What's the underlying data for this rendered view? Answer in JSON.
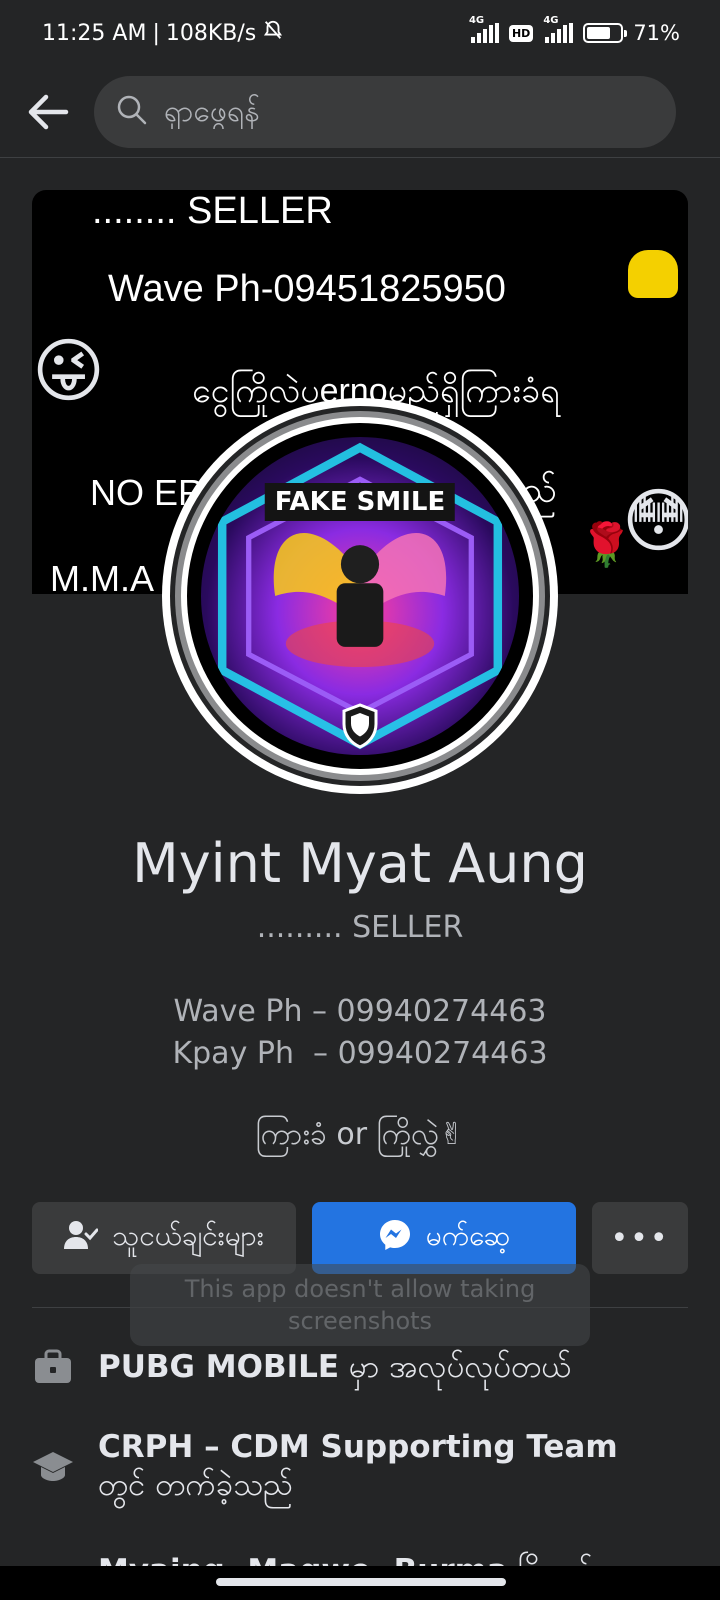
{
  "status_bar": {
    "time": "11:25 AM",
    "speed": "108KB/s",
    "network1": "4G",
    "hd": "HD",
    "network2": "4G",
    "battery": "71%",
    "battery_level": 0.71
  },
  "search": {
    "placeholder": "ရှာဖွေရန်"
  },
  "cover": {
    "line1": "........  SELLER",
    "line2": "Wave Ph-09451825950",
    "line3": "ငွေကြိုလဲပernoမည်ရှိကြားခံရ",
    "line4": "NO ER",
    "line4b": "ည်",
    "line5": "M.M.A"
  },
  "avatar": {
    "banner_text": "FAKE SMILE"
  },
  "profile": {
    "name": "Myint Myat Aung",
    "bio_line1": "......... SELLER",
    "bio_line2": "Wave Ph – 09940274463",
    "bio_line3": "Kpay Ph  – 09940274463",
    "bio_line4": "ကြားခံ or ကြိုလွှဲ✌"
  },
  "actions": {
    "friends_label": "သူငယ်ချင်းများ",
    "message_label": "မက်ဆေ့",
    "more_label": "•••"
  },
  "toast": {
    "text": "This app doesn't allow taking screenshots"
  },
  "details": {
    "work_bold": "PUBG MOBILE",
    "work_suffix": " မှာ အလုပ်လုပ်တယ်",
    "edu_bold": "CRPH – CDM Supporting Team",
    "edu_suffix": "တွင် တက်ခဲ့သည်",
    "location_bold": "Myaing, Magwe, Burma",
    "location_suffix": " မြို့တွင်"
  },
  "colors": {
    "background": "#242526",
    "accent": "#2374e1",
    "button_gray": "#3a3b3c"
  }
}
